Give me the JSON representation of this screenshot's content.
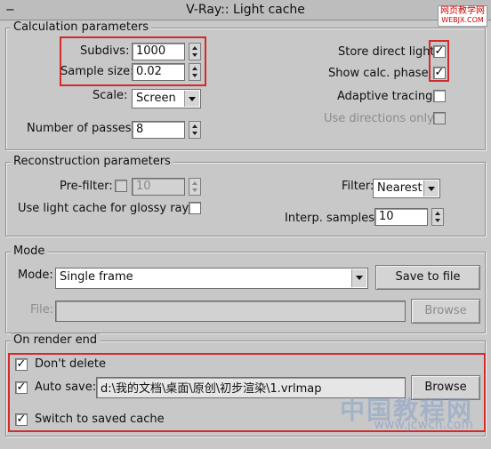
{
  "window": {
    "title": "V-Ray:: Light cache",
    "toggle": "−"
  },
  "watermark": {
    "top_line1": "网页教学网",
    "top_line2": "WEBJX.COM",
    "bottom_line1": "中国教程网",
    "bottom_line2": "www.jcwcn.com"
  },
  "calc": {
    "title": "Calculation parameters",
    "subdivs_label": "Subdivs:",
    "subdivs_value": "1000",
    "sample_size_label": "Sample size:",
    "sample_size_value": "0.02",
    "scale_label": "Scale:",
    "scale_value": "Screen",
    "passes_label": "Number of passes:",
    "passes_value": "8",
    "store_direct_label": "Store direct light",
    "store_direct_checked": "✓",
    "show_calc_label": "Show calc. phase",
    "show_calc_checked": "✓",
    "adaptive_label": "Adaptive tracing",
    "use_dirs_label": "Use directions only"
  },
  "recon": {
    "title": "Reconstruction parameters",
    "prefilter_label": "Pre-filter:",
    "prefilter_value": "10",
    "glossy_label": "Use light cache for glossy rays",
    "filter_label": "Filter:",
    "filter_value": "Nearest",
    "interp_label": "Interp. samples:",
    "interp_value": "10"
  },
  "mode": {
    "title": "Mode",
    "mode_label": "Mode:",
    "mode_value": "Single frame",
    "save_button": "Save to file",
    "file_label": "File:",
    "file_value": "",
    "browse_button": "Browse"
  },
  "render_end": {
    "title": "On render end",
    "dont_delete_label": "Don't delete",
    "dont_delete_checked": "✓",
    "auto_save_label": "Auto save:",
    "auto_save_checked": "✓",
    "auto_save_path": "d:\\我的文档\\桌面\\原创\\初步渲染\\1.vrlmap",
    "browse_button": "Browse",
    "switch_label": "Switch to saved cache",
    "switch_checked": "✓"
  }
}
